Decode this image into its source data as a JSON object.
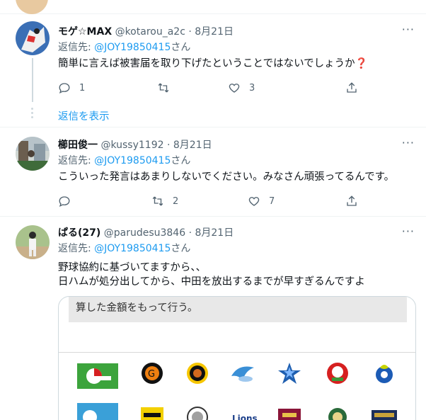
{
  "tweets": [
    {
      "name": "モゲ☆MAX",
      "handle": "@kotarou_a2c",
      "separator": "·",
      "date": "8月21日",
      "reply_prefix": "返信先:",
      "reply_target": "@JOY19850415",
      "reply_suffix": "さん",
      "text_lines": [
        "簡単に言えば被害届を取り下げたということではないでしょうか"
      ],
      "emoji": "❓",
      "reply_count": "1",
      "retweet_count": "",
      "like_count": "3",
      "show_replies": "返信を表示"
    },
    {
      "name": "櫛田俊一",
      "handle": "@kussy1192",
      "separator": "·",
      "date": "8月21日",
      "reply_prefix": "返信先:",
      "reply_target": "@JOY19850415",
      "reply_suffix": "さん",
      "text_lines": [
        "こういった発言はあまりしないでください。みなさん頑張ってるんです。"
      ],
      "reply_count": "",
      "retweet_count": "2",
      "like_count": "7"
    },
    {
      "name": "ぱる(27)",
      "handle": "@parudesu3846",
      "separator": "·",
      "date": "8月21日",
      "reply_prefix": "返信先:",
      "reply_target": "@JOY19850415",
      "reply_suffix": "さん",
      "text_lines": [
        "野球協約に基づいてますから、、",
        "日ハムが処分出してから、中田を放出するまでが早すぎるんですよ"
      ],
      "media_text": "算した金額をもって行う。"
    }
  ],
  "more_label": "···",
  "icons": [
    "reply-icon",
    "retweet-icon",
    "like-icon",
    "share-icon",
    "more-icon",
    "question-emoji-icon"
  ],
  "team_logos_row1": [
    "hiroshima-c-logo",
    "giants-logo",
    "hanshin-logo",
    "swallows-logo",
    "baystars-logo",
    "carp-logo",
    "dragons-logo"
  ],
  "team_logos_row2": [
    "logo-a",
    "softbank-logo",
    "logo-c",
    "lions-logo",
    "logo-e",
    "logo-f",
    "buffaloes-logo"
  ],
  "colors": {
    "accent": "#1d9bf0",
    "muted": "#536471",
    "text": "#0f1419",
    "border": "#eff3f4",
    "emoji_red": "#e0245e"
  }
}
